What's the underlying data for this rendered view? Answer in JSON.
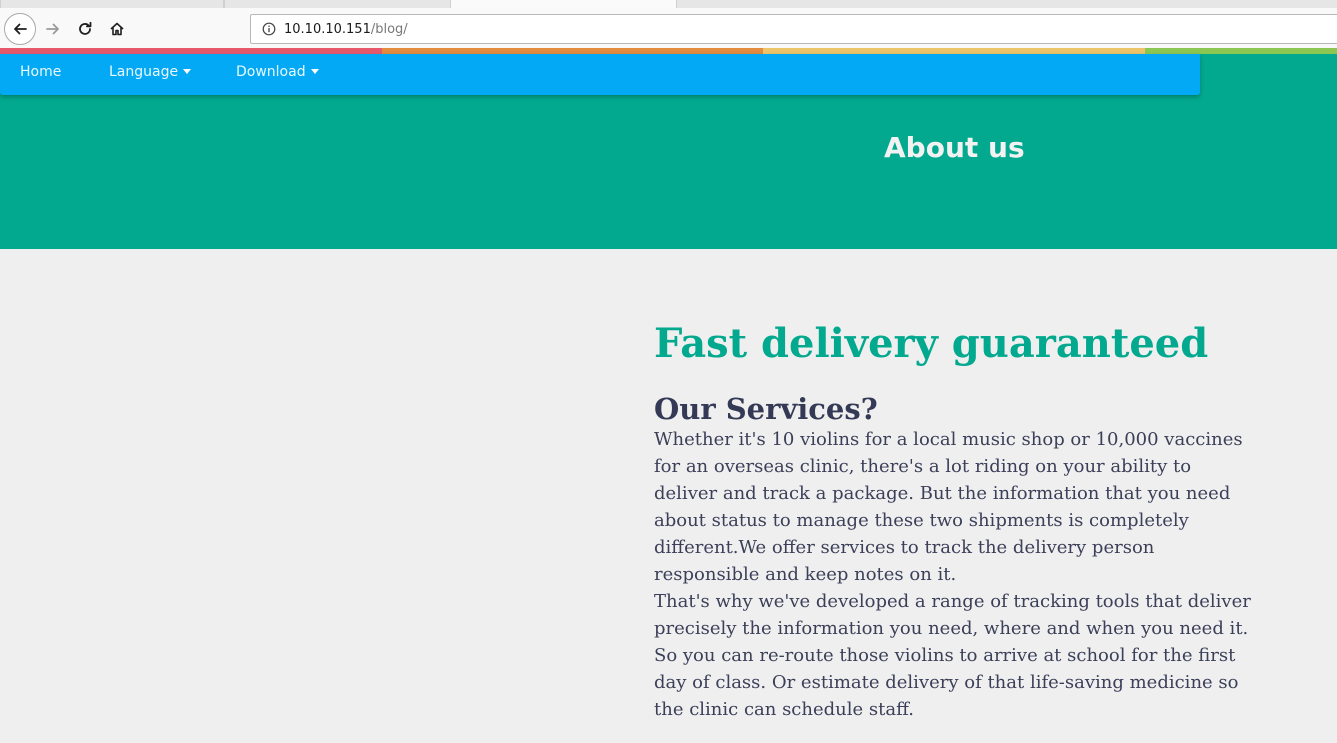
{
  "browser": {
    "url_host": "10.10.10.151",
    "url_path": "/blog/"
  },
  "nav": {
    "home": "Home",
    "language": "Language",
    "download": "Download"
  },
  "hero": {
    "title": "About us"
  },
  "content": {
    "headline": "Fast delivery guaranteed",
    "subheading": "Our Services?",
    "paragraph1": "Whether it's 10 violins for a local music shop or 10,000 vaccines for an overseas clinic, there's a lot riding on your ability to deliver and track a package. But the information that you need about status to manage these two shipments is completely different.We offer services to track the delivery person responsible and keep notes on it.",
    "paragraph2": "That's why we've developed a range of tracking tools that deliver precisely the information you need, where and when you need it. So you can re-route those violins to arrive at school for the first day of class. Or estimate delivery of that life-saving medicine so the clinic can schedule staff."
  },
  "colors": {
    "nav_bar": "#03a9f4",
    "hero_bg": "#02a98e",
    "headline": "#02a98e",
    "body_text": "#3b3f58",
    "page_bg": "#efefef",
    "stripe": [
      "#e6596b",
      "#e38b3f",
      "#eec46a",
      "#8cc653"
    ]
  },
  "icons": {
    "back": "back-arrow-icon",
    "forward": "forward-arrow-icon",
    "reload": "reload-icon",
    "home": "home-icon",
    "info": "info-icon",
    "caret": "caret-down-icon"
  }
}
